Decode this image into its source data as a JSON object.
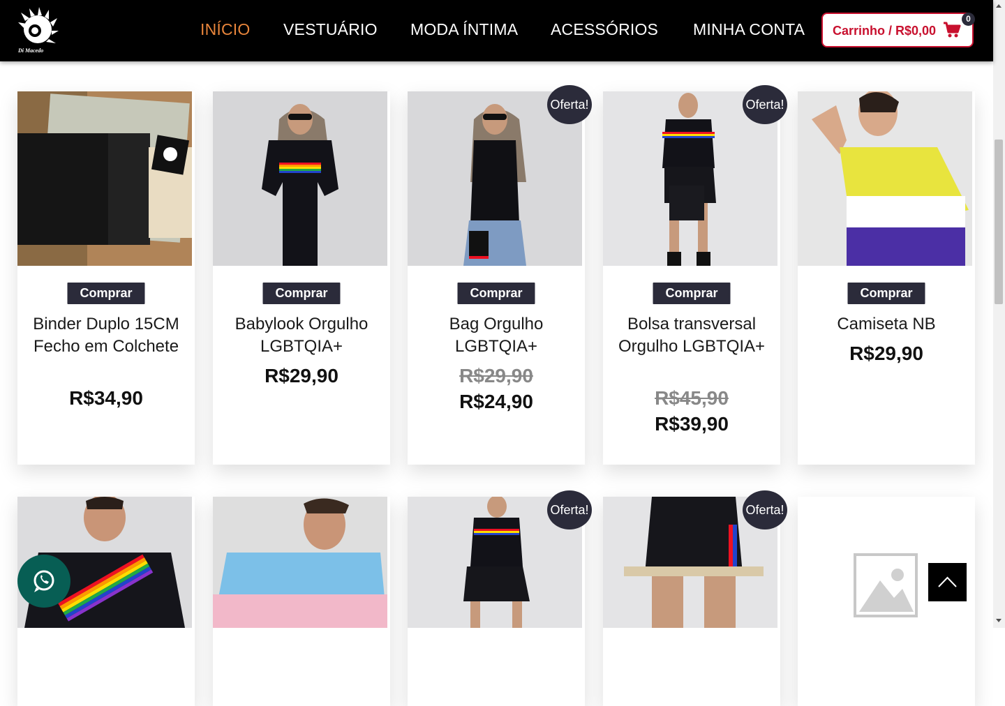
{
  "header": {
    "logo_text": "Di Macedo",
    "nav": [
      "INÍCIO",
      "VESTUÁRIO",
      "MODA ÍNTIMA",
      "ACESSÓRIOS",
      "MINHA CONTA"
    ],
    "cart_label": "Carrinho / R$0,00",
    "cart_count": "0",
    "active_color": "#e8853b",
    "cart_color": "#c8102e"
  },
  "products": [
    {
      "buy": "Comprar",
      "title": "Binder Duplo 15CM Fecho em Colchete",
      "price": "R$34,90",
      "old_price": "",
      "badge": ""
    },
    {
      "buy": "Comprar",
      "title": "Babylook Orgulho LGBTQIA+",
      "price": "R$29,90",
      "old_price": "",
      "badge": ""
    },
    {
      "buy": "Comprar",
      "title": "Bag Orgulho LGBTQIA+",
      "price": "R$24,90",
      "old_price": "R$29,90",
      "badge": "Oferta!"
    },
    {
      "buy": "Comprar",
      "title": "Bolsa transversal Orgulho LGBTQIA+",
      "price": "R$39,90",
      "old_price": "R$45,90",
      "badge": "Oferta!"
    },
    {
      "buy": "Comprar",
      "title": "Camiseta NB",
      "price": "R$29,90",
      "old_price": "",
      "badge": ""
    }
  ],
  "row2_badges": [
    "",
    "",
    "Oferta!",
    "Oferta!",
    ""
  ],
  "floating": {
    "whatsapp_icon": "whatsapp-icon",
    "scroll_top_icon": "chevron-up-icon"
  }
}
